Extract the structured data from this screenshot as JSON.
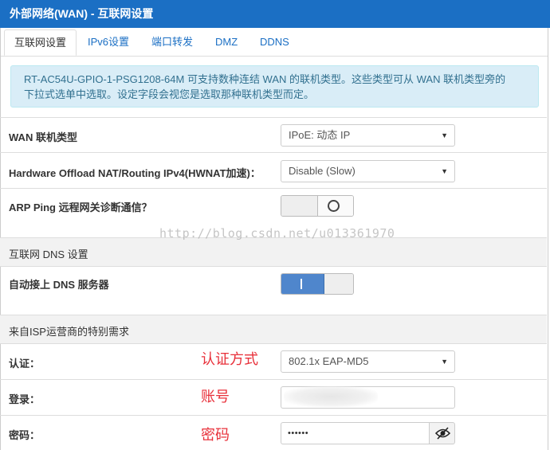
{
  "window": {
    "title": "外部网络(WAN) - 互联网设置"
  },
  "tabs": [
    {
      "label": "互联网设置"
    },
    {
      "label": "IPv6设置"
    },
    {
      "label": "端口转发"
    },
    {
      "label": "DMZ"
    },
    {
      "label": "DDNS"
    }
  ],
  "info": {
    "line1": "RT-AC54U-GPIO-1-PSG1208-64M 可支持数种连结 WAN 的联机类型。这些类型可从 WAN 联机类型旁的",
    "line2": "下拉式选单中选取。设定字段会视您是选取那种联机类型而定。"
  },
  "wan": {
    "type_label": "WAN 联机类型",
    "type_value": "IPoE: 动态 IP",
    "hwnat_label": "Hardware Offload NAT/Routing IPv4(HWNAT加速)：",
    "hwnat_value": "Disable (Slow)",
    "arp_label": "ARP Ping 远程网关诊断通信？",
    "arp_state": "off"
  },
  "dns": {
    "section_title": "互联网 DNS 设置",
    "auto_label": "自动接上 DNS 服务器",
    "auto_state": "on"
  },
  "isp": {
    "section_title": "来自ISP运营商的特别需求",
    "auth_label": "认证：",
    "auth_value": "802.1x EAP-MD5",
    "login_label": "登录：",
    "login_value": "",
    "password_label": "密码：",
    "password_value": "••••••"
  },
  "annotations": {
    "auth": "认证方式",
    "login": "账号",
    "password": "密码"
  },
  "watermark": "http://blog.csdn.net/u013361970",
  "icons": {
    "dropdown": "caret-down-icon",
    "toggle_off": "ring-icon",
    "toggle_on": "bar-icon",
    "eye": "eye-icon"
  },
  "colors": {
    "titlebar": "#1b6fc4",
    "link": "#1b6fc4",
    "alert_bg": "#d9edf7",
    "alert_text": "#31708f",
    "toggle_on": "#4f86cc",
    "annotation": "#e8303a"
  }
}
